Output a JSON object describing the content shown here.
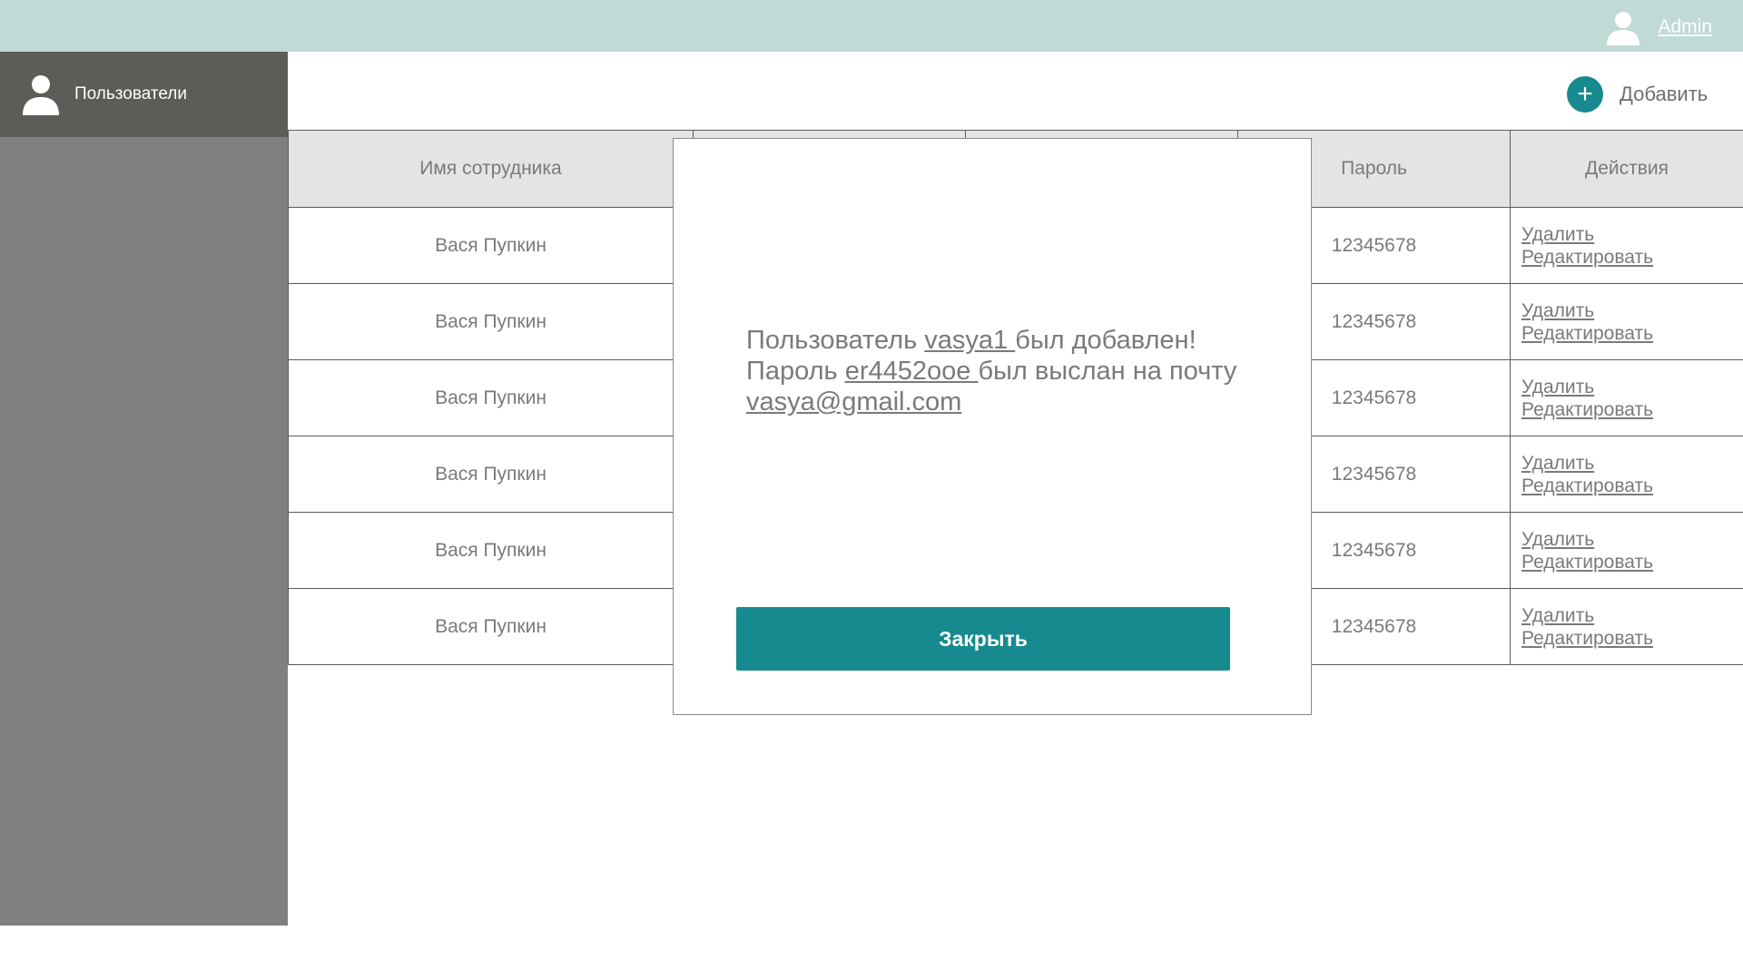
{
  "header": {
    "user_label": "Admin"
  },
  "sidebar": {
    "items": [
      {
        "label": "Пользователи"
      }
    ]
  },
  "toolbar": {
    "add_label": "Добавить"
  },
  "table": {
    "columns": [
      "Имя сотрудника",
      "",
      "",
      "Пароль",
      "Действия"
    ],
    "rows": [
      {
        "name": "Вася Пупкин",
        "password": "12345678",
        "delete": "Удалить",
        "edit": "Редактировать"
      },
      {
        "name": "Вася Пупкин",
        "password": "12345678",
        "delete": "Удалить",
        "edit": "Редактировать"
      },
      {
        "name": "Вася Пупкин",
        "password": "12345678",
        "delete": "Удалить",
        "edit": "Редактировать"
      },
      {
        "name": "Вася Пупкин",
        "password": "12345678",
        "delete": "Удалить",
        "edit": "Редактировать"
      },
      {
        "name": "Вася Пупкин",
        "password": "12345678",
        "delete": "Удалить",
        "edit": "Редактировать"
      },
      {
        "name": "Вася Пупкин",
        "password": "12345678",
        "delete": "Удалить",
        "edit": "Редактировать"
      }
    ]
  },
  "modal": {
    "text_1": "Пользователь ",
    "username": "vasya1 ",
    "text_2": "был добавлен! Пароль ",
    "password": "er4452ooe ",
    "text_3": "был выслан на почту ",
    "email": "vasya@gmail.com",
    "close_label": "Закрыть"
  },
  "icons": {
    "user": "user-icon",
    "add": "plus-icon"
  },
  "colors": {
    "accent": "#178a90",
    "header_bg": "#c0dad5",
    "sidebar_bg": "#808080",
    "sidebar_active": "#5d5c59"
  }
}
